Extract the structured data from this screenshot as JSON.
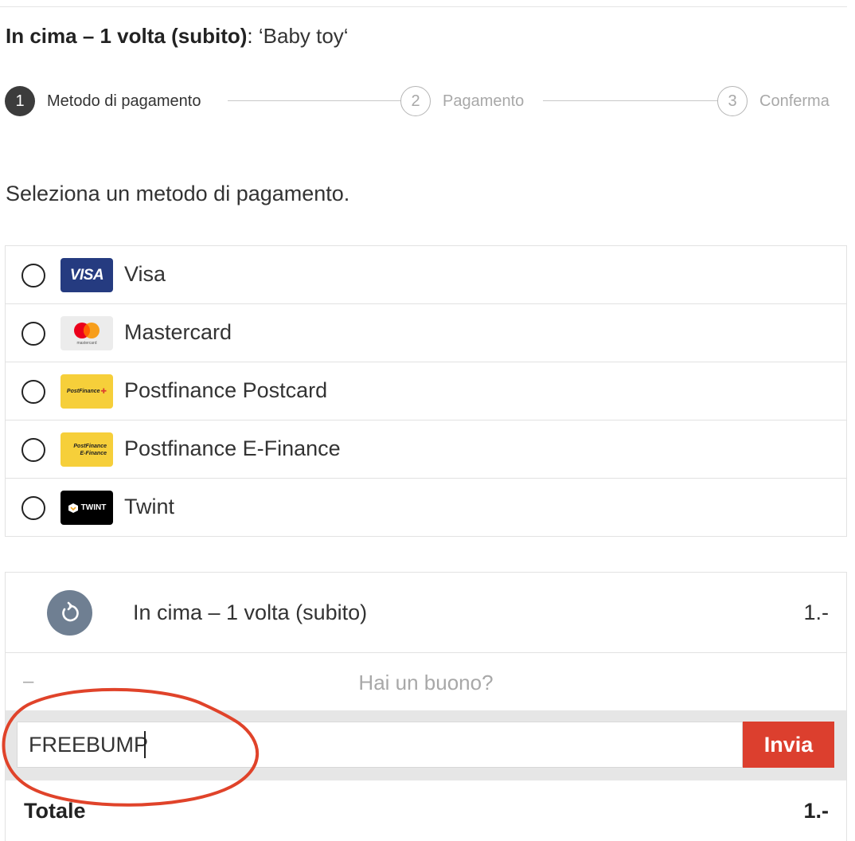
{
  "header": {
    "bold": "In cima – 1 volta (subito)",
    "separator": ": ",
    "product": "‘Baby toy‘"
  },
  "steps": [
    {
      "number": "1",
      "label": "Metodo di pagamento",
      "state": "active"
    },
    {
      "number": "2",
      "label": "Pagamento",
      "state": "inactive"
    },
    {
      "number": "3",
      "label": "Conferma",
      "state": "inactive"
    }
  ],
  "select_title": "Seleziona un metodo di pagamento.",
  "payment_methods": [
    {
      "label": "Visa",
      "logo_text": "VISA",
      "icon": "visa-logo"
    },
    {
      "label": "Mastercard",
      "logo_text": "mastercard",
      "icon": "mastercard-logo"
    },
    {
      "label": "Postfinance Postcard",
      "logo_text": "PostFinance",
      "icon": "postfinance-logo"
    },
    {
      "label": "Postfinance E-Finance",
      "logo_text": "PostFinance E-Finance",
      "logo_line1": "PostFinance",
      "logo_line2": "E-Finance",
      "icon": "efinance-logo"
    },
    {
      "label": "Twint",
      "logo_text": "TWINT",
      "icon": "twint-logo"
    }
  ],
  "summary": {
    "item_label": "In cima – 1 volta (subito)",
    "item_price": "1.-",
    "item_icon": "refresh-arrow-icon",
    "voucher_dash": "–",
    "voucher_prompt": "Hai un buono?",
    "voucher_value": "FREEBUMP",
    "submit_label": "Invia",
    "total_label": "Totale",
    "total_value": "1.-"
  },
  "colors": {
    "accent_red": "#dc3f2e",
    "step_active": "#3c3c3c",
    "icon_bg": "#6f7f92",
    "annotation": "#e0432a"
  }
}
